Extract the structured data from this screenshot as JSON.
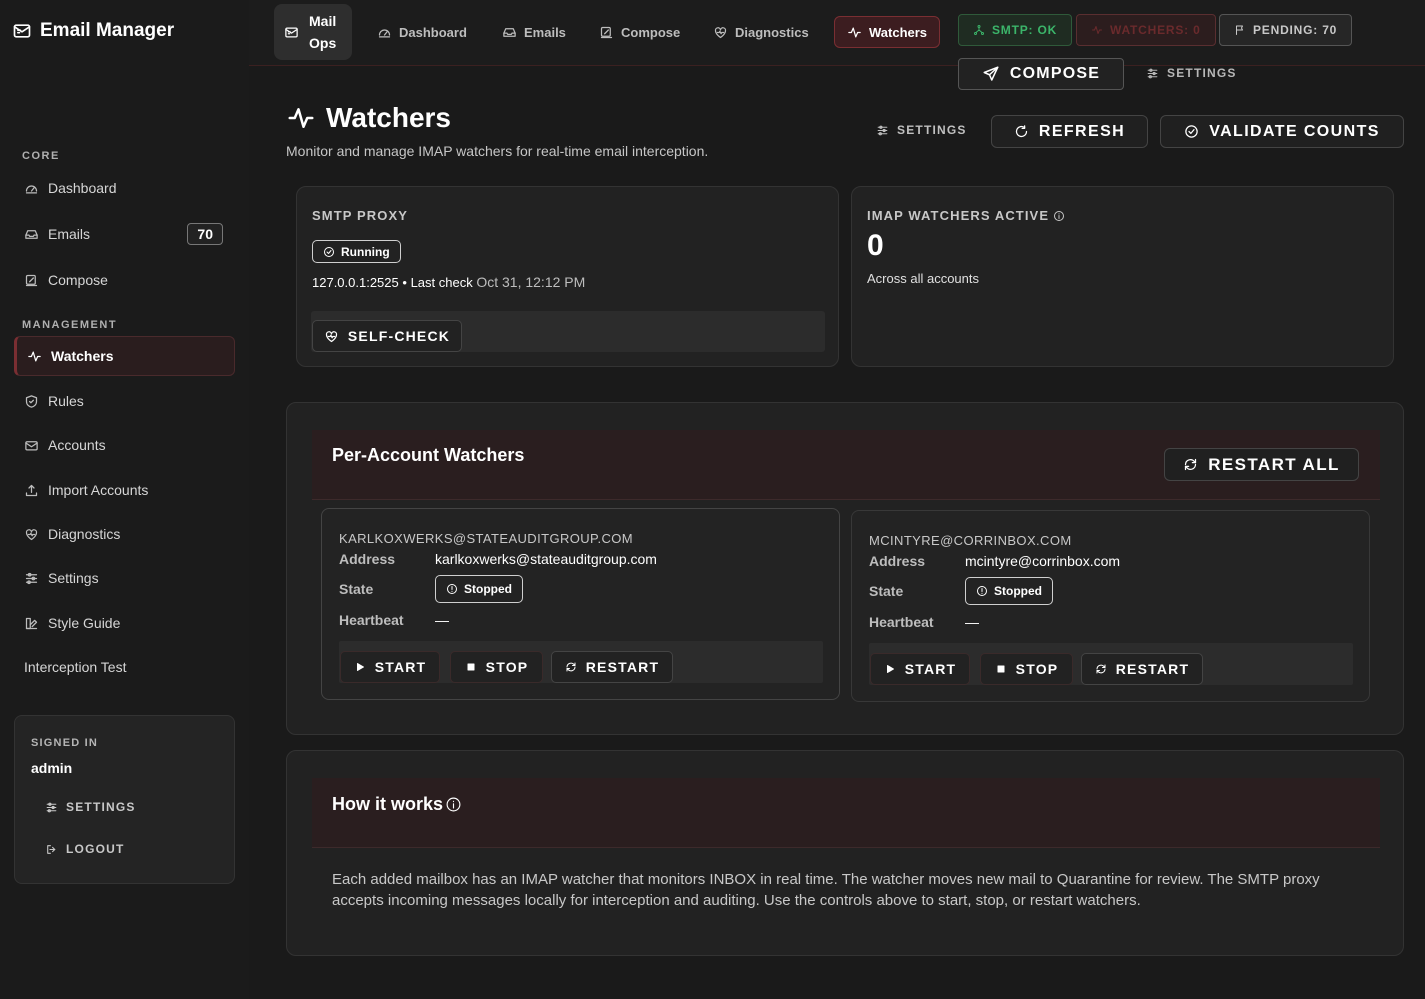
{
  "app": {
    "title": "Email Manager",
    "short_title_1": "Mail",
    "short_title_2": "Ops"
  },
  "sidebar": {
    "sections": {
      "core": "CORE",
      "management": "MANAGEMENT"
    },
    "items": [
      {
        "label": "Dashboard",
        "icon": "gauge-icon"
      },
      {
        "label": "Emails",
        "icon": "inbox-icon",
        "badge": "70"
      },
      {
        "label": "Compose",
        "icon": "edit-icon"
      },
      {
        "label": "Watchers",
        "icon": "activity-icon",
        "active": true
      },
      {
        "label": "Rules",
        "icon": "shield-icon"
      },
      {
        "label": "Accounts",
        "icon": "mail-stack-icon"
      },
      {
        "label": "Import Accounts",
        "icon": "upload-icon"
      },
      {
        "label": "Diagnostics",
        "icon": "heart-pulse-icon"
      },
      {
        "label": "Settings",
        "icon": "sliders-icon"
      },
      {
        "label": "Style Guide",
        "icon": "palette-icon"
      },
      {
        "label": "Interception Test"
      }
    ],
    "signed_in": {
      "label": "SIGNED IN",
      "user": "admin",
      "settings_label": "SETTINGS",
      "logout_label": "LOGOUT"
    }
  },
  "topbar": {
    "tabs": [
      {
        "label": "Dashboard"
      },
      {
        "label": "Emails"
      },
      {
        "label": "Compose"
      },
      {
        "label": "Diagnostics"
      },
      {
        "label": "Watchers",
        "active": true
      }
    ],
    "status": {
      "smtp": "SMTP: OK",
      "watchers": "WATCHERS: 0",
      "pending": "PENDING: 70"
    },
    "compose_label": "COMPOSE",
    "settings_label": "SETTINGS"
  },
  "page": {
    "title": "Watchers",
    "subtitle": "Monitor and manage IMAP watchers for real-time email interception.",
    "settings_label": "SETTINGS",
    "refresh_label": "REFRESH",
    "validate_label": "VALIDATE COUNTS"
  },
  "smtp_proxy": {
    "label": "SMTP PROXY",
    "status": "Running",
    "address": "127.0.0.1:2525",
    "bullet": "•",
    "last_check_label": "Last check",
    "last_check": "Oct 31, 12:12 PM",
    "selfcheck_label": "SELF-CHECK"
  },
  "imap": {
    "label": "IMAP WATCHERS ACTIVE",
    "count": "0",
    "desc": "Across all accounts"
  },
  "per_account": {
    "title": "Per-Account Watchers",
    "restart_all_label": "RESTART ALL",
    "field_labels": {
      "address": "Address",
      "state": "State",
      "heartbeat": "Heartbeat"
    },
    "action_labels": {
      "start": "START",
      "stop": "STOP",
      "restart": "RESTART"
    },
    "accounts": [
      {
        "header": "KARLKOXWERKS@STATEAUDITGROUP.COM",
        "address": "karlkoxwerks@stateauditgroup.com",
        "state": "Stopped",
        "heartbeat": "—"
      },
      {
        "header": "MCINTYRE@CORRINBOX.COM",
        "address": "mcintyre@corrinbox.com",
        "state": "Stopped",
        "heartbeat": "—"
      }
    ]
  },
  "how_it_works": {
    "title": "How it works",
    "text": "Each added mailbox has an IMAP watcher that monitors INBOX in real time. The watcher moves new mail to Quarantine for review. The SMTP proxy accepts incoming messages locally for interception and auditing. Use the controls above to start, stop, or restart watchers."
  },
  "colors": {
    "accent": "#7a2e32",
    "ok": "#3bb56a",
    "background": "#1a1a1a",
    "panel": "#222222"
  }
}
